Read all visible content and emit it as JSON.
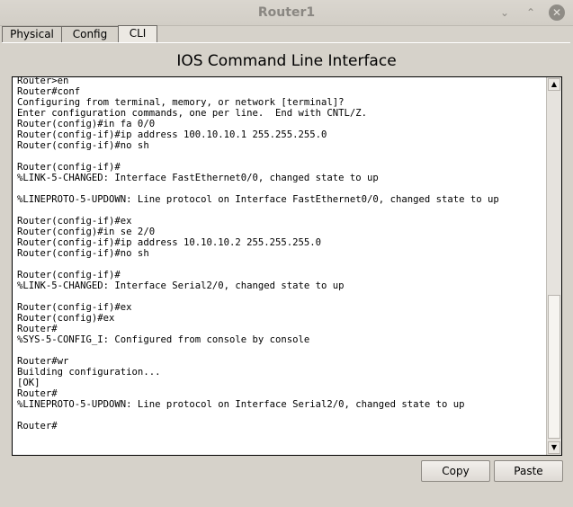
{
  "window": {
    "title": "Router1",
    "controls": {
      "minimize": "⌄",
      "maximize": "⌃",
      "close": "✕"
    }
  },
  "tabs": [
    {
      "label": "Physical"
    },
    {
      "label": "Config"
    },
    {
      "label": "CLI",
      "active": true
    }
  ],
  "cli": {
    "heading": "IOS Command Line Interface",
    "terminal_lines": [
      "",
      "",
      "",
      "",
      "",
      "",
      "",
      "Router>en",
      "Router#conf",
      "Configuring from terminal, memory, or network [terminal]?",
      "Enter configuration commands, one per line.  End with CNTL/Z.",
      "Router(config)#in fa 0/0",
      "Router(config-if)#ip address 100.10.10.1 255.255.255.0",
      "Router(config-if)#no sh",
      "",
      "Router(config-if)#",
      "%LINK-5-CHANGED: Interface FastEthernet0/0, changed state to up",
      "",
      "%LINEPROTO-5-UPDOWN: Line protocol on Interface FastEthernet0/0, changed state to up",
      "",
      "Router(config-if)#ex",
      "Router(config)#in se 2/0",
      "Router(config-if)#ip address 10.10.10.2 255.255.255.0",
      "Router(config-if)#no sh",
      "",
      "Router(config-if)#",
      "%LINK-5-CHANGED: Interface Serial2/0, changed state to up",
      "",
      "Router(config-if)#ex",
      "Router(config)#ex",
      "Router#",
      "%SYS-5-CONFIG_I: Configured from console by console",
      "",
      "Router#wr",
      "Building configuration...",
      "[OK]",
      "Router#",
      "%LINEPROTO-5-UPDOWN: Line protocol on Interface Serial2/0, changed state to up",
      "",
      "Router#"
    ],
    "scrollbar": {
      "up_arrow": "▲",
      "down_arrow": "▼",
      "position_fraction": 1.0
    }
  },
  "buttons": {
    "copy_label": "Copy",
    "paste_label": "Paste"
  }
}
